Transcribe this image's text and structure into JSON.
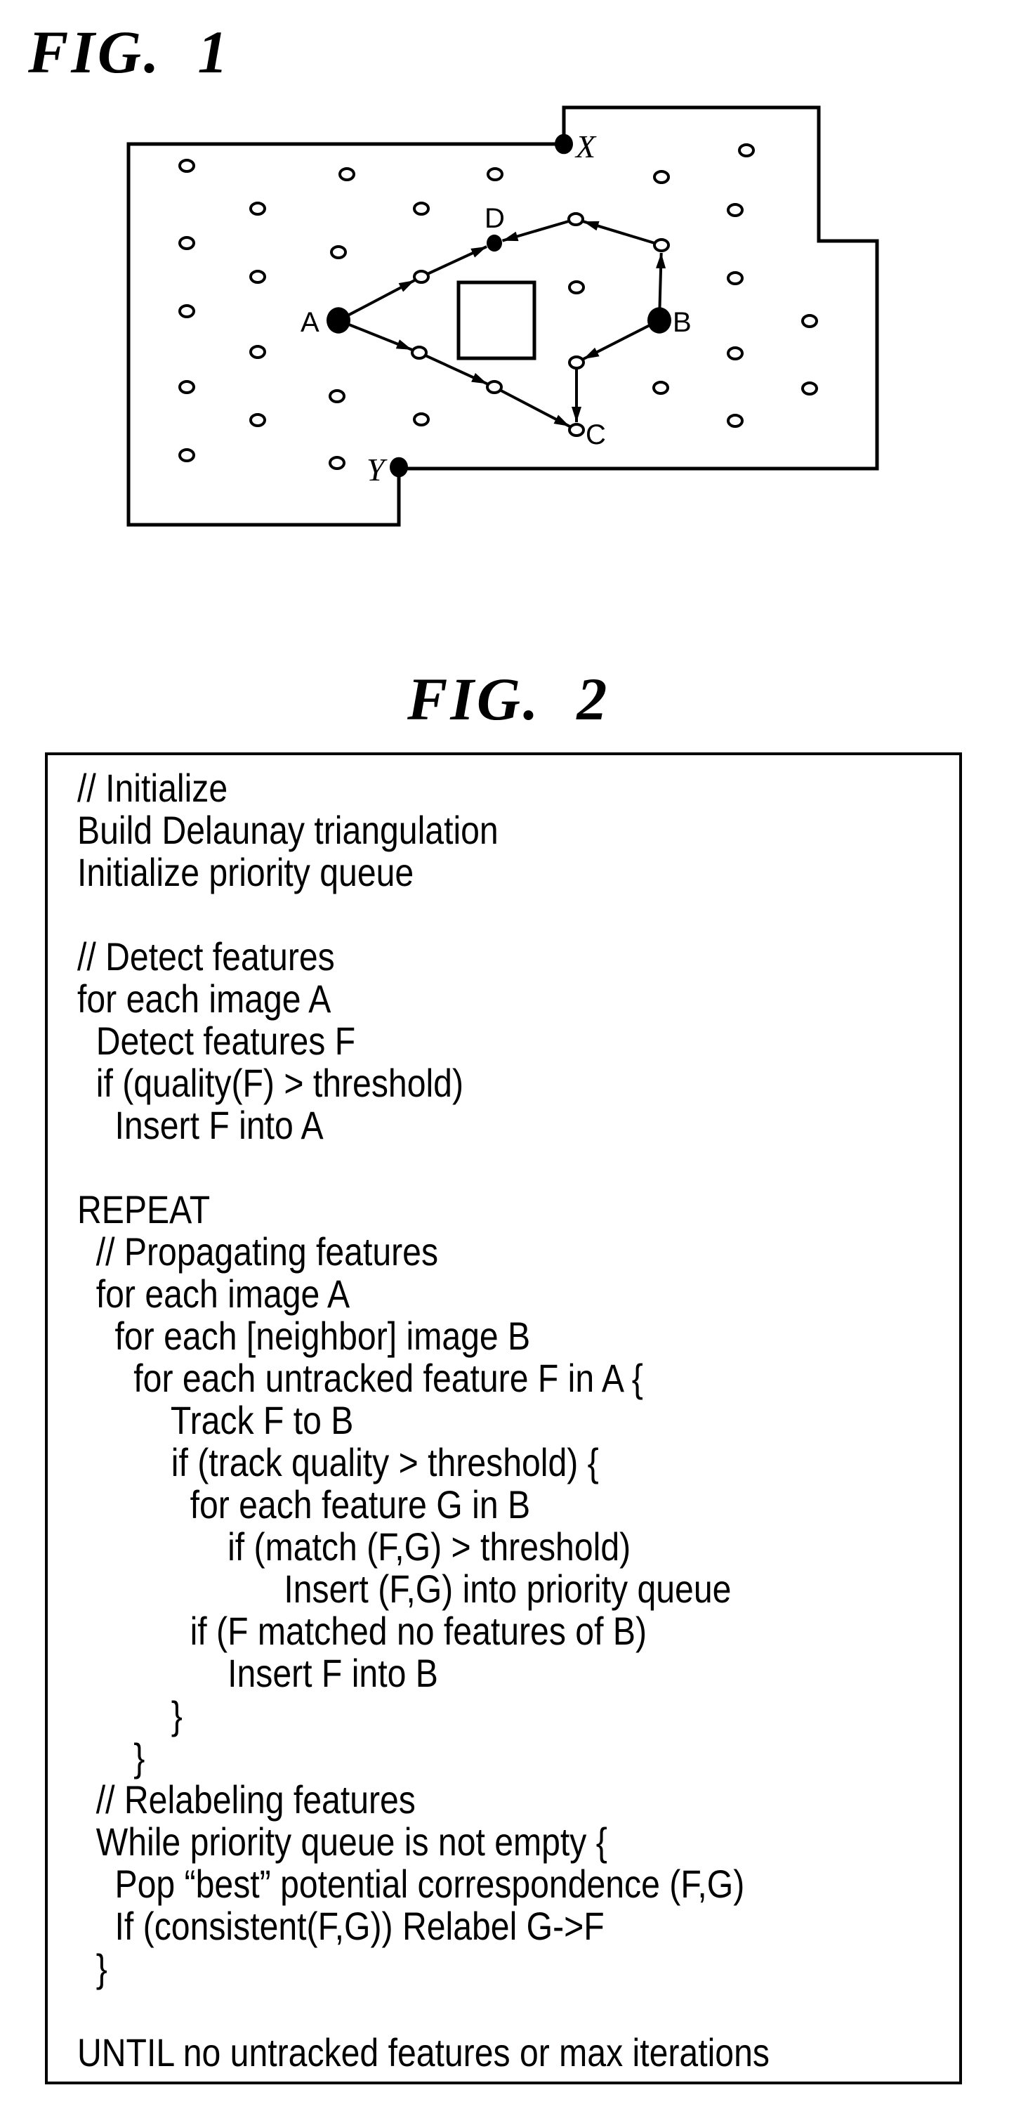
{
  "fig1": {
    "title": "FIG.  1",
    "labels": {
      "A": "A",
      "B": "B",
      "C": "C",
      "D": "D",
      "X": "X",
      "Y": "Y"
    }
  },
  "fig2": {
    "title": "FIG.  2",
    "code_lines": [
      "// Initialize",
      "Build Delaunay triangulation",
      "Initialize priority queue",
      "",
      "// Detect features",
      "for each image A",
      "  Detect features F",
      "  if (quality(F) > threshold)",
      "    Insert F into A",
      "",
      "REPEAT",
      "  // Propagating features",
      "  for each image A",
      "    for each [neighbor] image B",
      "      for each untracked feature F in A {",
      "          Track F to B",
      "          if (track quality > threshold) {",
      "            for each feature G in B",
      "                if (match (F,G) > threshold)",
      "                      Insert (F,G) into priority queue",
      "            if (F matched no features of B)",
      "                Insert F into B",
      "          }",
      "      }",
      "  // Relabeling features",
      "  While priority queue is not empty {",
      "    Pop “best” potential correspondence (F,G)",
      "    If (consistent(F,G)) Relabel G->F",
      "  }",
      "",
      "UNTIL no untracked features or max iterations"
    ]
  }
}
